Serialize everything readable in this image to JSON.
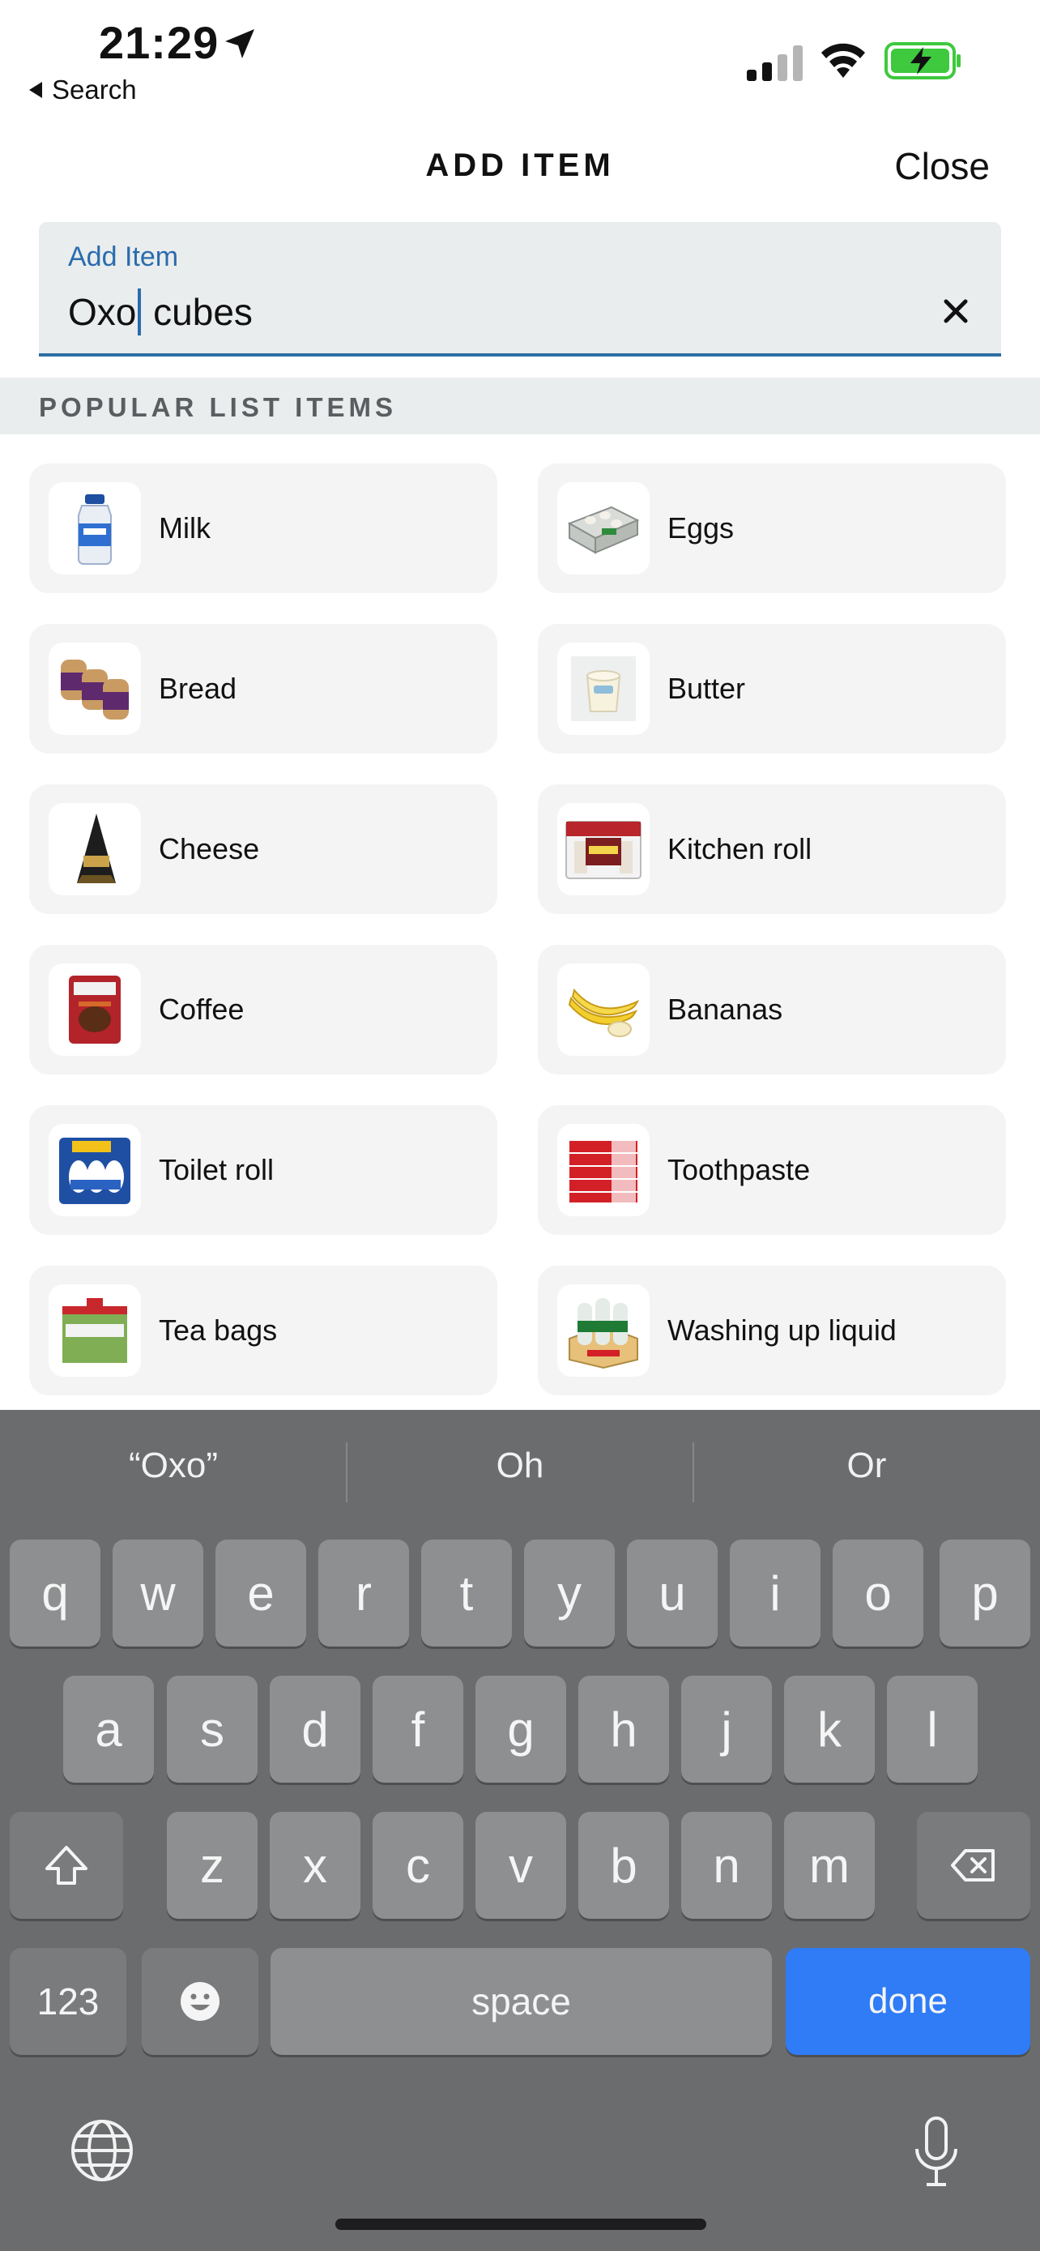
{
  "status_bar": {
    "time": "21:29",
    "back_app": "Search",
    "battery_color": "#3ec93e"
  },
  "header": {
    "title": "ADD ITEM",
    "close_label": "Close"
  },
  "add_item_field": {
    "label": "Add Item",
    "value_before_caret": "Oxo",
    "value_after_caret": " cubes",
    "accent_color": "#2a6cae"
  },
  "popular": {
    "section_title": "POPULAR LIST ITEMS",
    "items": [
      {
        "label": "Milk",
        "icon": "milk-bottle-icon"
      },
      {
        "label": "Eggs",
        "icon": "egg-carton-icon"
      },
      {
        "label": "Bread",
        "icon": "bread-loaves-icon"
      },
      {
        "label": "Butter",
        "icon": "butter-tub-icon"
      },
      {
        "label": "Cheese",
        "icon": "cheese-wedge-icon"
      },
      {
        "label": "Kitchen roll",
        "icon": "kitchen-roll-pack-icon"
      },
      {
        "label": "Coffee",
        "icon": "coffee-jar-icon"
      },
      {
        "label": "Bananas",
        "icon": "bananas-icon"
      },
      {
        "label": "Toilet roll",
        "icon": "toilet-roll-pack-icon"
      },
      {
        "label": "Toothpaste",
        "icon": "toothpaste-boxes-icon"
      },
      {
        "label": "Tea bags",
        "icon": "tea-bags-pack-icon"
      },
      {
        "label": "Washing up liquid",
        "icon": "washing-up-liquid-icon"
      }
    ]
  },
  "keyboard": {
    "suggestions": [
      "“Oxo”",
      "Oh",
      "Or"
    ],
    "row1": [
      "q",
      "w",
      "e",
      "r",
      "t",
      "y",
      "u",
      "i",
      "o",
      "p"
    ],
    "row2": [
      "a",
      "s",
      "d",
      "f",
      "g",
      "h",
      "j",
      "k",
      "l"
    ],
    "row3": [
      "z",
      "x",
      "c",
      "v",
      "b",
      "n",
      "m"
    ],
    "numbers_label": "123",
    "space_label": "space",
    "done_label": "done",
    "done_color": "#2f7cf6"
  }
}
